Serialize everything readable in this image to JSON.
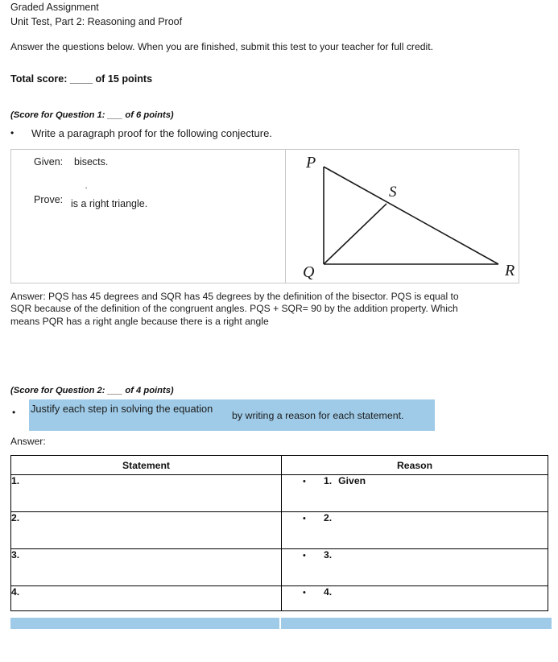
{
  "document": {
    "title": "Graded Assignment",
    "subtitle": "Unit Test, Part 2: Reasoning and Proof",
    "instructions": "Answer the questions below. When you are finished, submit this test to your teacher for full credit.",
    "total_score": "Total score: ____ of 15 points"
  },
  "question1": {
    "score_line": "(Score for Question 1: ___ of 6 points)",
    "bullet": "•",
    "prompt": "Write a paragraph proof for the following conjecture.",
    "given_label": "Given:",
    "given_value": "bisects.",
    "given_dot": "·",
    "prove_label": "Prove:",
    "prove_value": "is a right triangle.",
    "figure": {
      "vertex_p": "P",
      "vertex_q": "Q",
      "vertex_r": "R",
      "point_s": "S"
    },
    "answer": "Answer:  PQS has 45 degrees and SQR has 45 degrees by the definition of the bisector. PQS is equal to SQR because of the definition of the congruent angles. PQS + SQR= 90 by the addition property. Which means PQR has a right angle because there is a right angle"
  },
  "question2": {
    "score_line": "(Score for Question 2: ___ of 4 points)",
    "bullet": "•",
    "prompt_part1": "Justify each step in solving the equation",
    "prompt_part2": "by writing a reason for each statement.",
    "answer_label": "Answer:",
    "highlight_color": "#9fcbe8",
    "table": {
      "headers": [
        "Statement",
        "Reason"
      ],
      "rows": [
        {
          "statement": "1.",
          "reason_bullet": "•",
          "reason_num": "1.",
          "reason_text": "Given"
        },
        {
          "statement": "2.",
          "reason_bullet": "•",
          "reason_num": "2.",
          "reason_text": ""
        },
        {
          "statement": "3.",
          "reason_bullet": "•",
          "reason_num": "3.",
          "reason_text": ""
        },
        {
          "statement": "4.",
          "reason_bullet": "•",
          "reason_num": "4.",
          "reason_text": ""
        }
      ]
    }
  }
}
